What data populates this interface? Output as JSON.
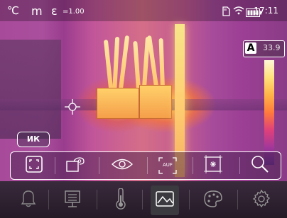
{
  "status": {
    "unit": "℃",
    "mode": "m",
    "emissivity_symbol": "ε",
    "emissivity": "=1.00",
    "time": "17:11"
  },
  "scale": {
    "auto_badge": "A",
    "max_temp": "33.9"
  },
  "ik_button": "ИК",
  "toolbar": {
    "items": [
      "fullscreen-icon",
      "camera-icon",
      "eye-icon",
      "auto-focus-icon",
      "image-frame-icon",
      "search-icon"
    ],
    "af_label": "AUF"
  },
  "bottom_nav": {
    "items": [
      "bell-icon",
      "menu-icon",
      "thermometer-icon",
      "image-icon",
      "palette-icon",
      "gear-icon"
    ],
    "active": "image-icon"
  },
  "colors": {
    "accent": "#ffffff",
    "bar_bg": "#2a1f2c"
  }
}
